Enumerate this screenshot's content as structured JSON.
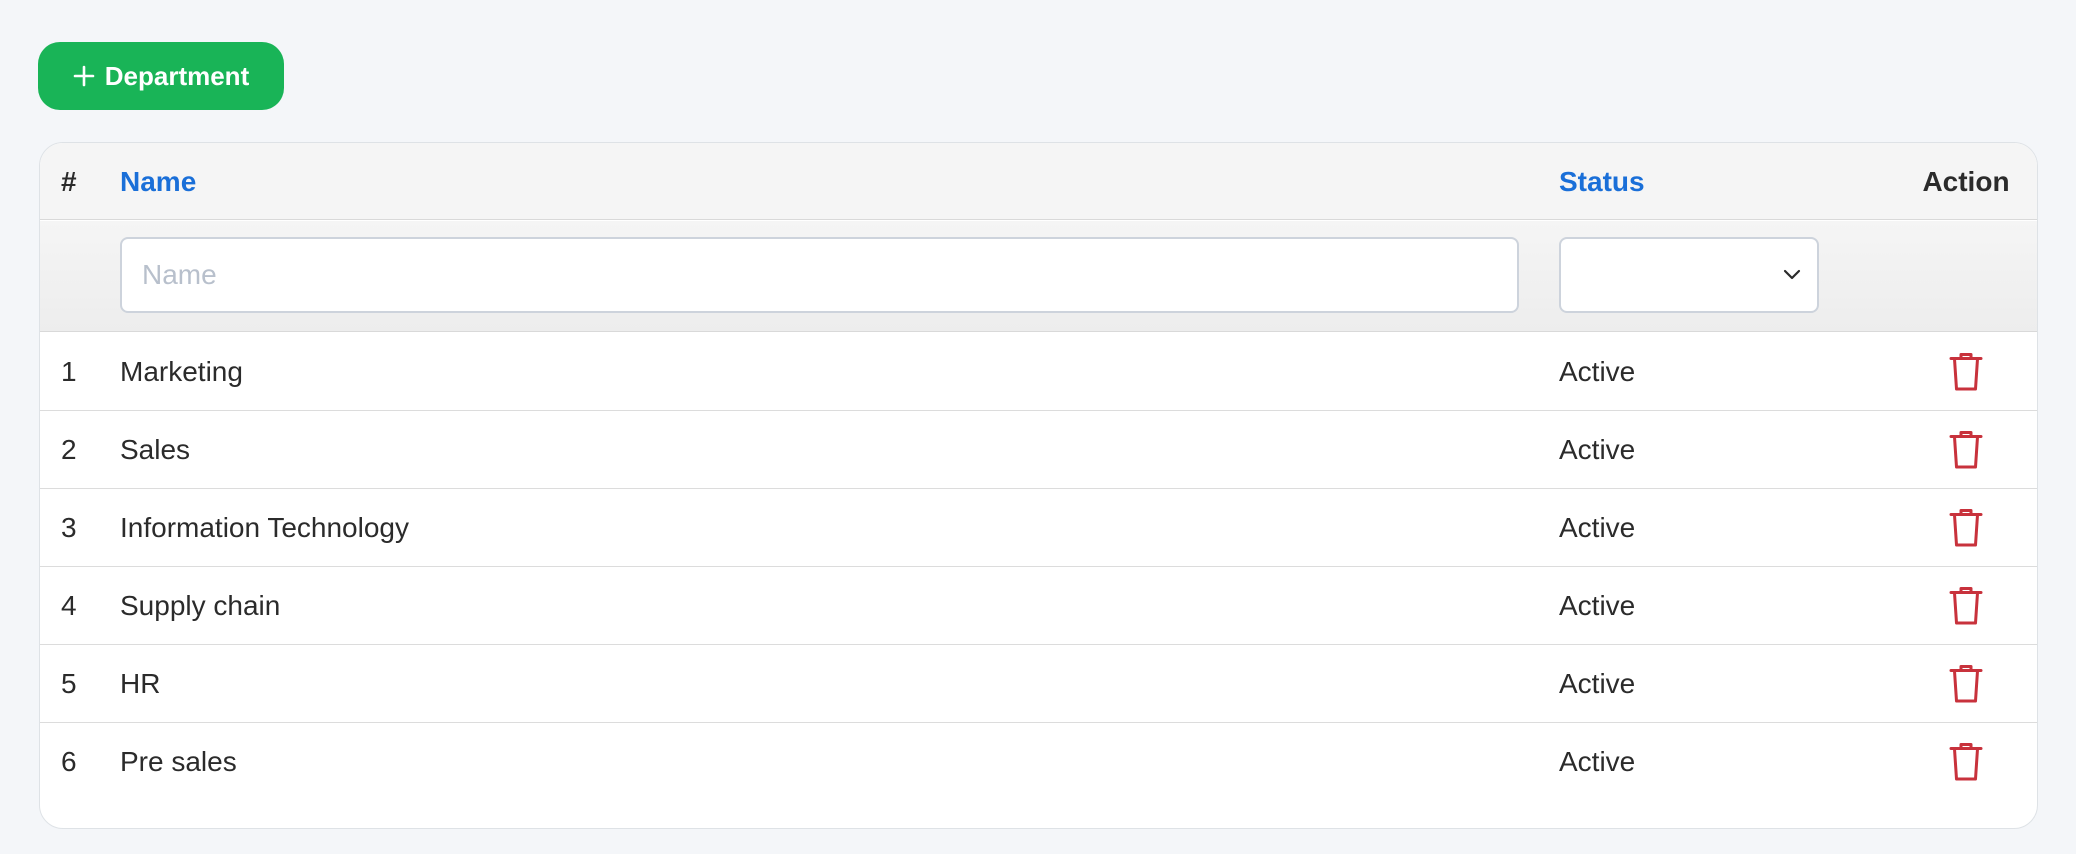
{
  "toolbar": {
    "add_button_label": "Department",
    "add_icon": "plus-icon"
  },
  "table": {
    "columns": {
      "number": "#",
      "name": "Name",
      "status": "Status",
      "action": "Action"
    },
    "filters": {
      "name_placeholder": "Name",
      "name_value": "",
      "status_value": ""
    },
    "rows": [
      {
        "number": "1",
        "name": "Marketing",
        "status": "Active"
      },
      {
        "number": "2",
        "name": "Sales",
        "status": "Active"
      },
      {
        "number": "3",
        "name": "Information Technology",
        "status": "Active"
      },
      {
        "number": "4",
        "name": "Supply chain",
        "status": "Active"
      },
      {
        "number": "5",
        "name": "HR",
        "status": "Active"
      },
      {
        "number": "6",
        "name": "Pre sales",
        "status": "Active"
      }
    ],
    "row_action_icon": "trash-icon"
  },
  "colors": {
    "page_background": "#f4f6f9",
    "add_button": "#19b457",
    "sortable_header": "#1a6fd8",
    "delete_icon": "#c8323c",
    "placeholder": "#b8c0cc"
  }
}
